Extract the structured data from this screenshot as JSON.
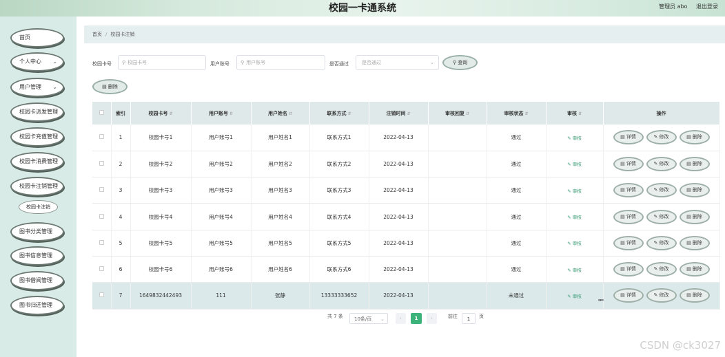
{
  "header": {
    "title": "校园一卡通系统",
    "user_label": "管理员 abo",
    "logout": "退出登录"
  },
  "sidebar": {
    "items": [
      {
        "label": "首页",
        "chevron": false
      },
      {
        "label": "个人中心",
        "chevron": true
      },
      {
        "label": "用户管理",
        "chevron": true
      },
      {
        "label": "校园卡派发管理",
        "chevron": false
      },
      {
        "label": "校园卡充值管理",
        "chevron": false
      },
      {
        "label": "校园卡消费管理",
        "chevron": false
      },
      {
        "label": "校园卡注销管理",
        "chevron": false
      },
      {
        "label": "图书分类管理",
        "chevron": false
      },
      {
        "label": "图书信息管理",
        "chevron": false
      },
      {
        "label": "图书借阅管理",
        "chevron": false
      },
      {
        "label": "图书归还管理",
        "chevron": false
      }
    ],
    "submenu": {
      "label": "校园卡注销"
    }
  },
  "breadcrumb": {
    "home": "首页",
    "sep": "/",
    "current": "校园卡注销"
  },
  "search": {
    "card_label": "校园卡号",
    "card_placeholder": "校园卡号",
    "account_label": "用户账号",
    "account_placeholder": "用户账号",
    "pass_label": "是否通过",
    "pass_placeholder": "是否通过",
    "query_button": "查询",
    "delete_button": "删除"
  },
  "table": {
    "headers": [
      "索引",
      "校园卡号",
      "用户账号",
      "用户姓名",
      "联系方式",
      "注销时间",
      "审核回复",
      "审核状态",
      "审核",
      "操作"
    ],
    "rows": [
      {
        "index": "1",
        "card": "校园卡号1",
        "account": "用户账号1",
        "name": "用户姓名1",
        "contact": "联系方式1",
        "time": "2022-04-13",
        "reply": "",
        "status": "通过"
      },
      {
        "index": "2",
        "card": "校园卡号2",
        "account": "用户账号2",
        "name": "用户姓名2",
        "contact": "联系方式2",
        "time": "2022-04-13",
        "reply": "",
        "status": "通过"
      },
      {
        "index": "3",
        "card": "校园卡号3",
        "account": "用户账号3",
        "name": "用户姓名3",
        "contact": "联系方式3",
        "time": "2022-04-13",
        "reply": "",
        "status": "通过"
      },
      {
        "index": "4",
        "card": "校园卡号4",
        "account": "用户账号4",
        "name": "用户姓名4",
        "contact": "联系方式4",
        "time": "2022-04-13",
        "reply": "",
        "status": "通过"
      },
      {
        "index": "5",
        "card": "校园卡号5",
        "account": "用户账号5",
        "name": "用户姓名5",
        "contact": "联系方式5",
        "time": "2022-04-13",
        "reply": "",
        "status": "通过"
      },
      {
        "index": "6",
        "card": "校园卡号6",
        "account": "用户账号6",
        "name": "用户姓名6",
        "contact": "联系方式6",
        "time": "2022-04-13",
        "reply": "",
        "status": "通过"
      },
      {
        "index": "7",
        "card": "1649832442493",
        "account": "111",
        "name": "张静",
        "contact": "13333333652",
        "time": "2022-04-13",
        "reply": "",
        "status": "未通过"
      }
    ],
    "audit_label": "审核",
    "detail_label": "详情",
    "edit_label": "修改",
    "delete_label": "删除"
  },
  "pagination": {
    "total": "共 7 条",
    "page_size": "10条/页",
    "current_page": "1",
    "goto_label": "前往",
    "goto_value": "1",
    "page_suffix": "页"
  },
  "watermark": "CSDN @ck3027",
  "colors": {
    "accent": "#3bb37a",
    "sidebar_bg": "#d9ebe7",
    "header_bg": "#d5e9dc"
  }
}
